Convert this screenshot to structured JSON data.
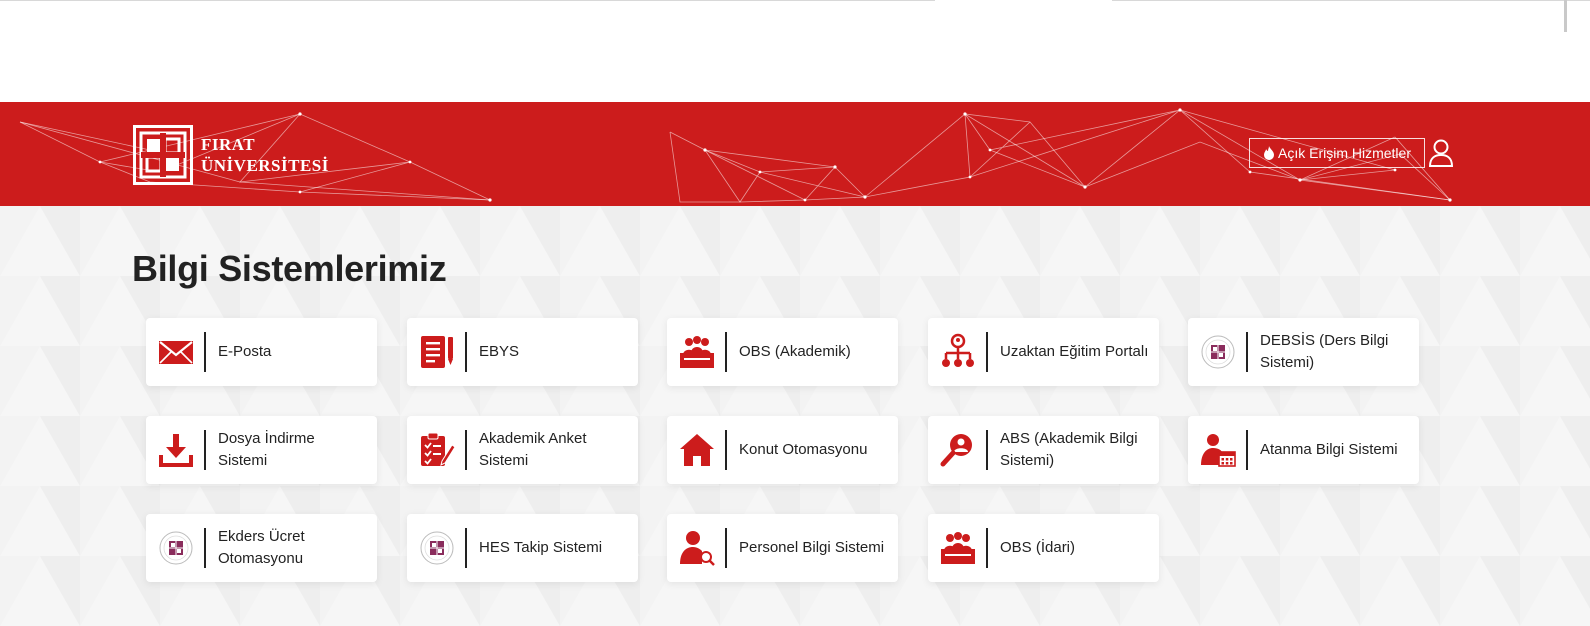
{
  "header": {
    "logo_line1": "FIRAT",
    "logo_line2": "ÜNİVERSİTESİ",
    "access_label": "Açık Erişim Hizmetler"
  },
  "page": {
    "title": "Bilgi Sistemlerimiz"
  },
  "systems": [
    {
      "label": "E-Posta",
      "icon": "mail-icon"
    },
    {
      "label": "EBYS",
      "icon": "document-icon"
    },
    {
      "label": "OBS (Akademik)",
      "icon": "audience-icon"
    },
    {
      "label": "Uzaktan Eğitim Portalı",
      "icon": "network-users-icon"
    },
    {
      "label": "DEBSİS (Ders Bilgi Sistemi)",
      "icon": "university-seal-icon"
    },
    {
      "label": "Dosya İndirme Sistemi",
      "icon": "download-icon"
    },
    {
      "label": "Akademik Anket Sistemi",
      "icon": "checklist-icon"
    },
    {
      "label": "Konut Otomasyonu",
      "icon": "home-icon"
    },
    {
      "label": "ABS (Akademik Bilgi Sistemi)",
      "icon": "user-search-icon"
    },
    {
      "label": "Atanma Bilgi Sistemi",
      "icon": "user-calendar-icon"
    },
    {
      "label": "Ekders Ücret Otomasyonu",
      "icon": "university-seal-icon"
    },
    {
      "label": "HES Takip Sistemi",
      "icon": "university-seal-icon"
    },
    {
      "label": "Personel Bilgi Sistemi",
      "icon": "person-search-icon"
    },
    {
      "label": "OBS (İdari)",
      "icon": "audience-icon"
    }
  ],
  "colors": {
    "brand": "#cc1c1c",
    "text": "#222222",
    "background": "#f3f3f3"
  }
}
